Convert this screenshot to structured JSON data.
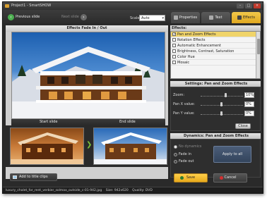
{
  "window": {
    "title": "Project1 - SmartSHOW"
  },
  "toolbar": {
    "prev_label": "Previous slide",
    "next_label": "Next slide",
    "scale_label": "Scale:",
    "scale_value": "Auto"
  },
  "tabs": [
    {
      "label": "Properties"
    },
    {
      "label": "Text"
    },
    {
      "label": "Effects"
    }
  ],
  "preview": {
    "title": "Effects Fade In / Out",
    "start_label": "Start slide",
    "end_label": "End slide"
  },
  "add_button": "Add to title clips",
  "effects": {
    "header": "Effects:",
    "items": [
      {
        "label": "Pan and Zoom Effects",
        "checked": true
      },
      {
        "label": "Rotation Effects",
        "checked": false
      },
      {
        "label": "Automatic Enhancement",
        "checked": false
      },
      {
        "label": "Brightness, Contrast, Saturation",
        "checked": false
      },
      {
        "label": "Color Hue",
        "checked": false
      },
      {
        "label": "Mosaic",
        "checked": false
      }
    ]
  },
  "settings": {
    "header": "Settings: Pan and Zoom Effects",
    "zoom_label": "Zoom:",
    "zoom_value": "10%",
    "panx_label": "Pan X value:",
    "panx_value": "0%",
    "pany_label": "Pan Y value:",
    "pany_value": "0%",
    "close_label": "Close"
  },
  "dynamics": {
    "header": "Dynamics: Pan and Zoom Effects",
    "options": [
      {
        "label": "No dynamics",
        "selected": true,
        "disabled": true
      },
      {
        "label": "Fade in",
        "selected": false,
        "disabled": false
      },
      {
        "label": "Fade out",
        "selected": false,
        "disabled": false
      }
    ],
    "apply_label": "Apply to all"
  },
  "buttons": {
    "save": "Save",
    "cancel": "Cancel"
  },
  "status": {
    "filename": "luxury_chalet_for_rent_verbier_solmax_outside_c-01-942.jpg",
    "size": "Size: 942x620",
    "quality": "Quality: DVD"
  },
  "colors": {
    "accent": "#e7a91c",
    "panel": "#2e2e2e",
    "selected": "#f0d46a"
  }
}
